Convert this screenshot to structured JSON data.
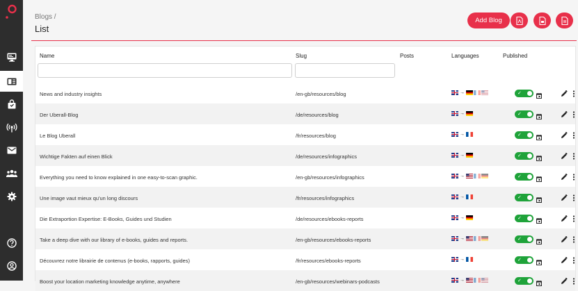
{
  "header": {
    "breadcrumb": "Blogs /",
    "title": "List",
    "add_button_label": "Add Blog"
  },
  "sidebar": {
    "logo_icon": "target-logo-icon",
    "items": [
      {
        "icon": "monitor-icon",
        "active": false
      },
      {
        "icon": "blog-layout-icon",
        "active": true
      },
      {
        "icon": "shopping-bag-icon",
        "active": false
      },
      {
        "icon": "broadcast-icon",
        "active": false
      },
      {
        "icon": "mail-icon",
        "active": false
      },
      {
        "icon": "people-icon",
        "active": false
      },
      {
        "icon": "gear-icon",
        "active": false
      },
      {
        "icon": "help-icon",
        "active": false
      },
      {
        "icon": "account-icon",
        "active": false
      }
    ]
  },
  "table": {
    "columns": {
      "name": "Name",
      "slug": "Slug",
      "posts": "Posts",
      "languages": "Languages",
      "published": "Published"
    },
    "filters": {
      "name": "",
      "slug": ""
    },
    "rows": [
      {
        "name": "News and industry insights",
        "slug": "/en-gb/resources/blog",
        "flags": [
          "uk",
          "arrow",
          "de",
          "fr",
          "us"
        ],
        "published": true
      },
      {
        "name": "Der Uberall-Blog",
        "slug": "/de/resources/blog",
        "flags": [
          "uk",
          "arrow",
          "de"
        ],
        "published": true
      },
      {
        "name": "Le Blog Uberall",
        "slug": "/fr/resources/blog",
        "flags": [
          "uk",
          "arrow",
          "fr"
        ],
        "published": true
      },
      {
        "name": "Wichtige Fakten auf einen Blick",
        "slug": "/de/resources/infographics",
        "flags": [
          "uk",
          "arrow",
          "de"
        ],
        "published": true
      },
      {
        "name": "Everything you need to know explained in one easy-to-scan graphic.",
        "slug": "/en-gb/resources/infographics",
        "flags": [
          "uk",
          "arrow",
          "us",
          "fr",
          "de"
        ],
        "published": true
      },
      {
        "name": "Une image vaut mieux qu'un long discours",
        "slug": "/fr/resources/infographics",
        "flags": [
          "uk",
          "arrow",
          "fr"
        ],
        "published": true
      },
      {
        "name": "Die Extraportion Expertise: E-Books, Guides und Studien",
        "slug": "/de/resources/ebooks-reports",
        "flags": [
          "uk",
          "arrow",
          "de"
        ],
        "published": true
      },
      {
        "name": "Take a deep dive with our library of e-books, guides and reports.",
        "slug": "/en-gb/resources/ebooks-reports",
        "flags": [
          "uk",
          "arrow",
          "us",
          "fr",
          "de"
        ],
        "published": true
      },
      {
        "name": "Découvrez notre librairie de contenus (e-books, rapports, guides)",
        "slug": "/fr/resources/ebooks-reports",
        "flags": [
          "uk",
          "arrow",
          "fr"
        ],
        "published": true
      },
      {
        "name": "Boost your location marketing knowledge anytime, anywhere",
        "slug": "/en-gb/resources/webinars-podcasts",
        "flags": [
          "uk",
          "arrow",
          "us",
          "fr",
          "us"
        ],
        "published": true
      }
    ]
  },
  "colors": {
    "accent": "#e8304a",
    "sidebar": "#2d2d2d",
    "toggle_on": "#1fa33a"
  }
}
